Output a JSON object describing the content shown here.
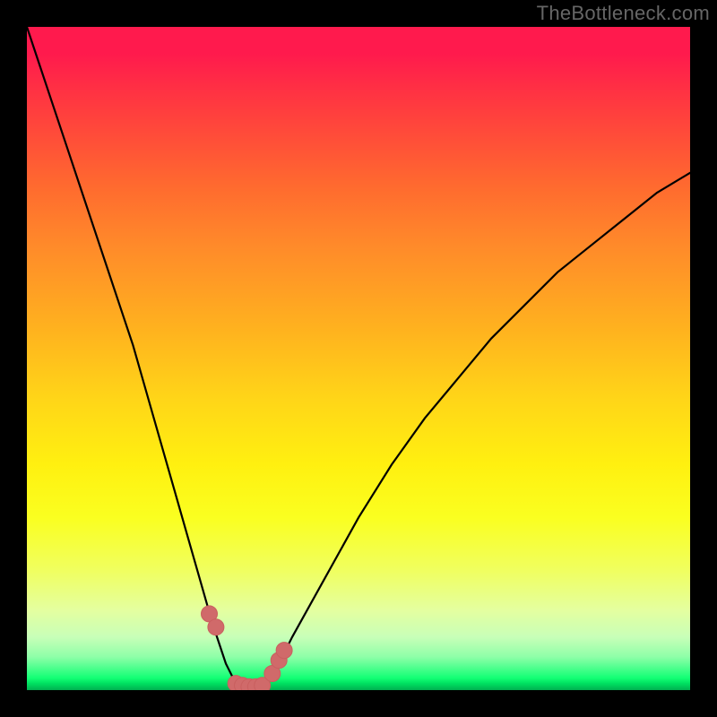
{
  "watermark": "TheBottleneck.com",
  "colors": {
    "bg": "#000000",
    "curve": "#000000",
    "marker": "#d06a6a",
    "marker_stroke": "#c95f5f"
  },
  "chart_data": {
    "type": "line",
    "title": "",
    "xlabel": "",
    "ylabel": "",
    "xlim": [
      0,
      100
    ],
    "ylim": [
      0,
      100
    ],
    "x": [
      0,
      2,
      4,
      6,
      8,
      10,
      12,
      14,
      16,
      18,
      20,
      22,
      24,
      26,
      28,
      30,
      31,
      32,
      33,
      34,
      35,
      36,
      37,
      38,
      40,
      45,
      50,
      55,
      60,
      65,
      70,
      75,
      80,
      85,
      90,
      95,
      100
    ],
    "values": [
      100,
      94,
      88,
      82,
      76,
      70,
      64,
      58,
      52,
      45,
      38,
      31,
      24,
      17,
      10,
      4,
      2,
      1,
      0.5,
      0.5,
      0.5,
      1,
      2,
      4,
      8,
      17,
      26,
      34,
      41,
      47,
      53,
      58,
      63,
      67,
      71,
      75,
      78
    ],
    "markers": {
      "x": [
        27.5,
        28.5,
        31.5,
        32.5,
        33.5,
        34.5,
        35.5,
        37.0,
        38.0,
        38.8
      ],
      "y": [
        11.5,
        9.5,
        1.0,
        0.7,
        0.5,
        0.5,
        0.7,
        2.5,
        4.5,
        6.0
      ]
    },
    "gradient_bands": [
      {
        "pos": 0,
        "color": "#ff1a4d"
      },
      {
        "pos": 50,
        "color": "#ffd518"
      },
      {
        "pos": 95,
        "color": "#40ff88"
      },
      {
        "pos": 100,
        "color": "#00b050"
      }
    ]
  }
}
